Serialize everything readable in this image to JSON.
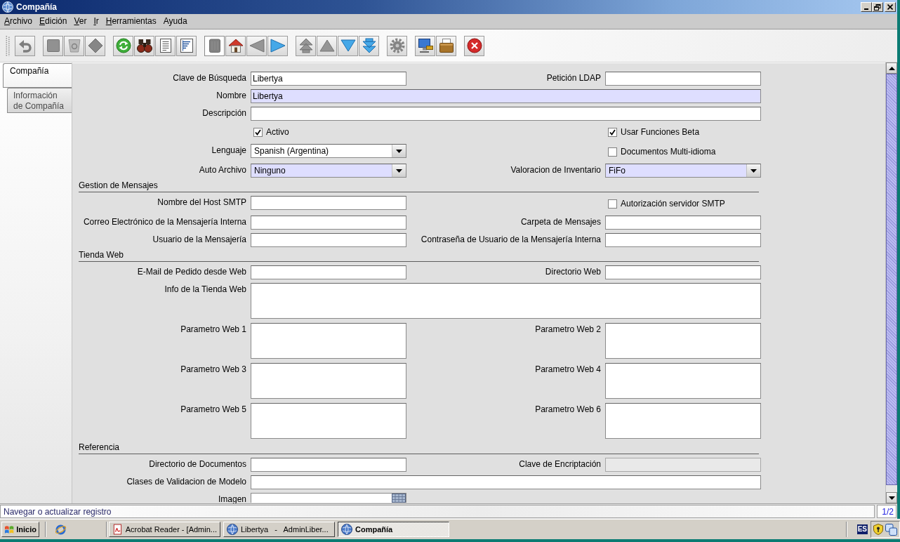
{
  "window": {
    "title": "Compañía"
  },
  "menu": [
    {
      "label": "Archivo",
      "mnemonic": true
    },
    {
      "label": "Edición",
      "mnemonic": true
    },
    {
      "label": "Ver",
      "mnemonic": true
    },
    {
      "label": "Ir",
      "mnemonic": true
    },
    {
      "label": "Herramientas",
      "mnemonic": true
    },
    {
      "label": "Ayuda",
      "mnemonic": false
    }
  ],
  "toolbar": {
    "groups": [
      [
        {
          "disabled": true,
          "pressed": false
        }
      ],
      [
        {
          "disabled": true,
          "pressed": false
        },
        {
          "disabled": true,
          "pressed": false
        },
        {
          "disabled": true,
          "pressed": false
        }
      ],
      [
        {
          "disabled": false,
          "pressed": false
        },
        {
          "disabled": false,
          "pressed": false
        },
        {
          "disabled": false,
          "pressed": false
        },
        {
          "disabled": false,
          "pressed": false
        }
      ],
      [
        {
          "disabled": true,
          "pressed": true
        },
        {
          "disabled": false,
          "pressed": false
        },
        {
          "disabled": true,
          "pressed": false
        },
        {
          "disabled": false,
          "pressed": false
        }
      ],
      [
        {
          "disabled": true,
          "pressed": false
        },
        {
          "disabled": true,
          "pressed": false
        },
        {
          "disabled": false,
          "pressed": false
        },
        {
          "disabled": false,
          "pressed": false
        }
      ],
      [
        {
          "disabled": true,
          "pressed": false
        }
      ],
      [
        {
          "disabled": false,
          "pressed": false
        },
        {
          "disabled": false,
          "pressed": false
        }
      ],
      [
        {
          "disabled": false,
          "pressed": false
        }
      ]
    ]
  },
  "tabs": [
    {
      "label": "Compañía",
      "selected": true
    },
    {
      "label": "Información de Compañía",
      "selected": false
    }
  ],
  "form": {
    "rows": [
      {
        "kind": "fields",
        "left": {
          "kind": "text",
          "label": "Clave de Búsqueda",
          "value": "Libertya",
          "mandatory": false,
          "disabled": false
        },
        "right": {
          "kind": "text",
          "label": "Petición LDAP",
          "mandatory": false,
          "disabled": false
        }
      },
      {
        "kind": "fields",
        "full": {
          "kind": "text",
          "label": "Nombre",
          "value": "Libertya",
          "mandatory": true,
          "disabled": false
        }
      },
      {
        "kind": "fields",
        "full": {
          "kind": "text",
          "label": "Descripción",
          "mandatory": false,
          "disabled": false
        }
      },
      {
        "kind": "fields",
        "left": {
          "kind": "checkbox",
          "label": "Activo",
          "checked": true
        },
        "right": {
          "kind": "checkbox",
          "label": "Usar Funciones Beta",
          "checked": true
        }
      },
      {
        "kind": "fields",
        "left": {
          "kind": "select",
          "label": "Lenguaje",
          "value": "Spanish (Argentina)",
          "mandatory": false,
          "disabled": false
        },
        "right": {
          "kind": "checkbox",
          "label": "Documentos Multi-idioma",
          "checked": false
        }
      },
      {
        "kind": "fields",
        "left": {
          "kind": "select",
          "label": "Auto Archivo",
          "value": "Ninguno",
          "mandatory": true,
          "disabled": false
        },
        "right": {
          "kind": "select",
          "label": "Valoracion de Inventario",
          "value": "FiFo",
          "mandatory": true,
          "disabled": false
        }
      },
      {
        "kind": "section",
        "label": "Gestion de Mensajes"
      },
      {
        "kind": "fields",
        "left": {
          "kind": "text",
          "label": "Nombre del Host SMTP",
          "mandatory": false,
          "disabled": false
        },
        "right": {
          "kind": "checkbox",
          "label": "Autorización servidor SMTP",
          "checked": false
        }
      },
      {
        "kind": "fields",
        "left": {
          "kind": "text",
          "label": "Correo Electrónico de la Mensajería Interna",
          "mandatory": false,
          "disabled": false
        },
        "right": {
          "kind": "text",
          "label": "Carpeta de Mensajes",
          "mandatory": false,
          "disabled": false
        }
      },
      {
        "kind": "fields",
        "left": {
          "kind": "text",
          "label": "Usuario de la Mensajería",
          "mandatory": false,
          "disabled": false
        },
        "right": {
          "kind": "text",
          "label": "Contraseña de Usuario de la Mensajería Interna",
          "mandatory": false,
          "disabled": false
        }
      },
      {
        "kind": "section",
        "label": "Tienda Web"
      },
      {
        "kind": "fields",
        "left": {
          "kind": "text",
          "label": "E-Mail de Pedido desde Web",
          "mandatory": false,
          "disabled": false
        },
        "right": {
          "kind": "text",
          "label": "Directorio Web",
          "mandatory": false,
          "disabled": false
        }
      },
      {
        "kind": "fields",
        "full": {
          "kind": "textarea",
          "label": "Info de la Tienda Web",
          "mandatory": false,
          "disabled": false
        }
      },
      {
        "kind": "fields",
        "left": {
          "kind": "textarea",
          "label": "Parametro Web 1",
          "mandatory": false,
          "disabled": false
        },
        "right": {
          "kind": "textarea",
          "label": "Parametro Web 2",
          "mandatory": false,
          "disabled": false
        }
      },
      {
        "kind": "fields",
        "left": {
          "kind": "textarea",
          "label": "Parametro Web 3",
          "mandatory": false,
          "disabled": false
        },
        "right": {
          "kind": "textarea",
          "label": "Parametro Web 4",
          "mandatory": false,
          "disabled": false
        }
      },
      {
        "kind": "fields",
        "left": {
          "kind": "textarea",
          "label": "Parametro Web 5",
          "mandatory": false,
          "disabled": false
        },
        "right": {
          "kind": "textarea",
          "label": "Parametro Web 6",
          "mandatory": false,
          "disabled": false
        }
      },
      {
        "kind": "section",
        "label": "Referencia"
      },
      {
        "kind": "fields",
        "left": {
          "kind": "text",
          "label": "Directorio de Documentos",
          "mandatory": false,
          "disabled": false
        },
        "right": {
          "kind": "text",
          "label": "Clave de Encriptación",
          "mandatory": false,
          "disabled": true
        }
      },
      {
        "kind": "fields",
        "full": {
          "kind": "text",
          "label": "Clases de Validacion de Modelo",
          "mandatory": false,
          "disabled": false
        }
      },
      {
        "kind": "fields",
        "left": {
          "kind": "image",
          "label": "Imagen",
          "mandatory": false,
          "disabled": false
        }
      }
    ]
  },
  "status_bar": {
    "message": "Navegar o actualizar registro",
    "record": "1/2"
  },
  "taskbar": {
    "start": "Inicio",
    "tasks": [
      {
        "kind": "reader",
        "label": "Acrobat Reader - [Admin...",
        "selected": false
      },
      {
        "kind": "window",
        "label": "Libertya   -   AdminLiber...",
        "selected": false
      },
      {
        "kind": "window",
        "label": "Compañía",
        "selected": true
      }
    ],
    "tray": {
      "language": "ES"
    }
  }
}
